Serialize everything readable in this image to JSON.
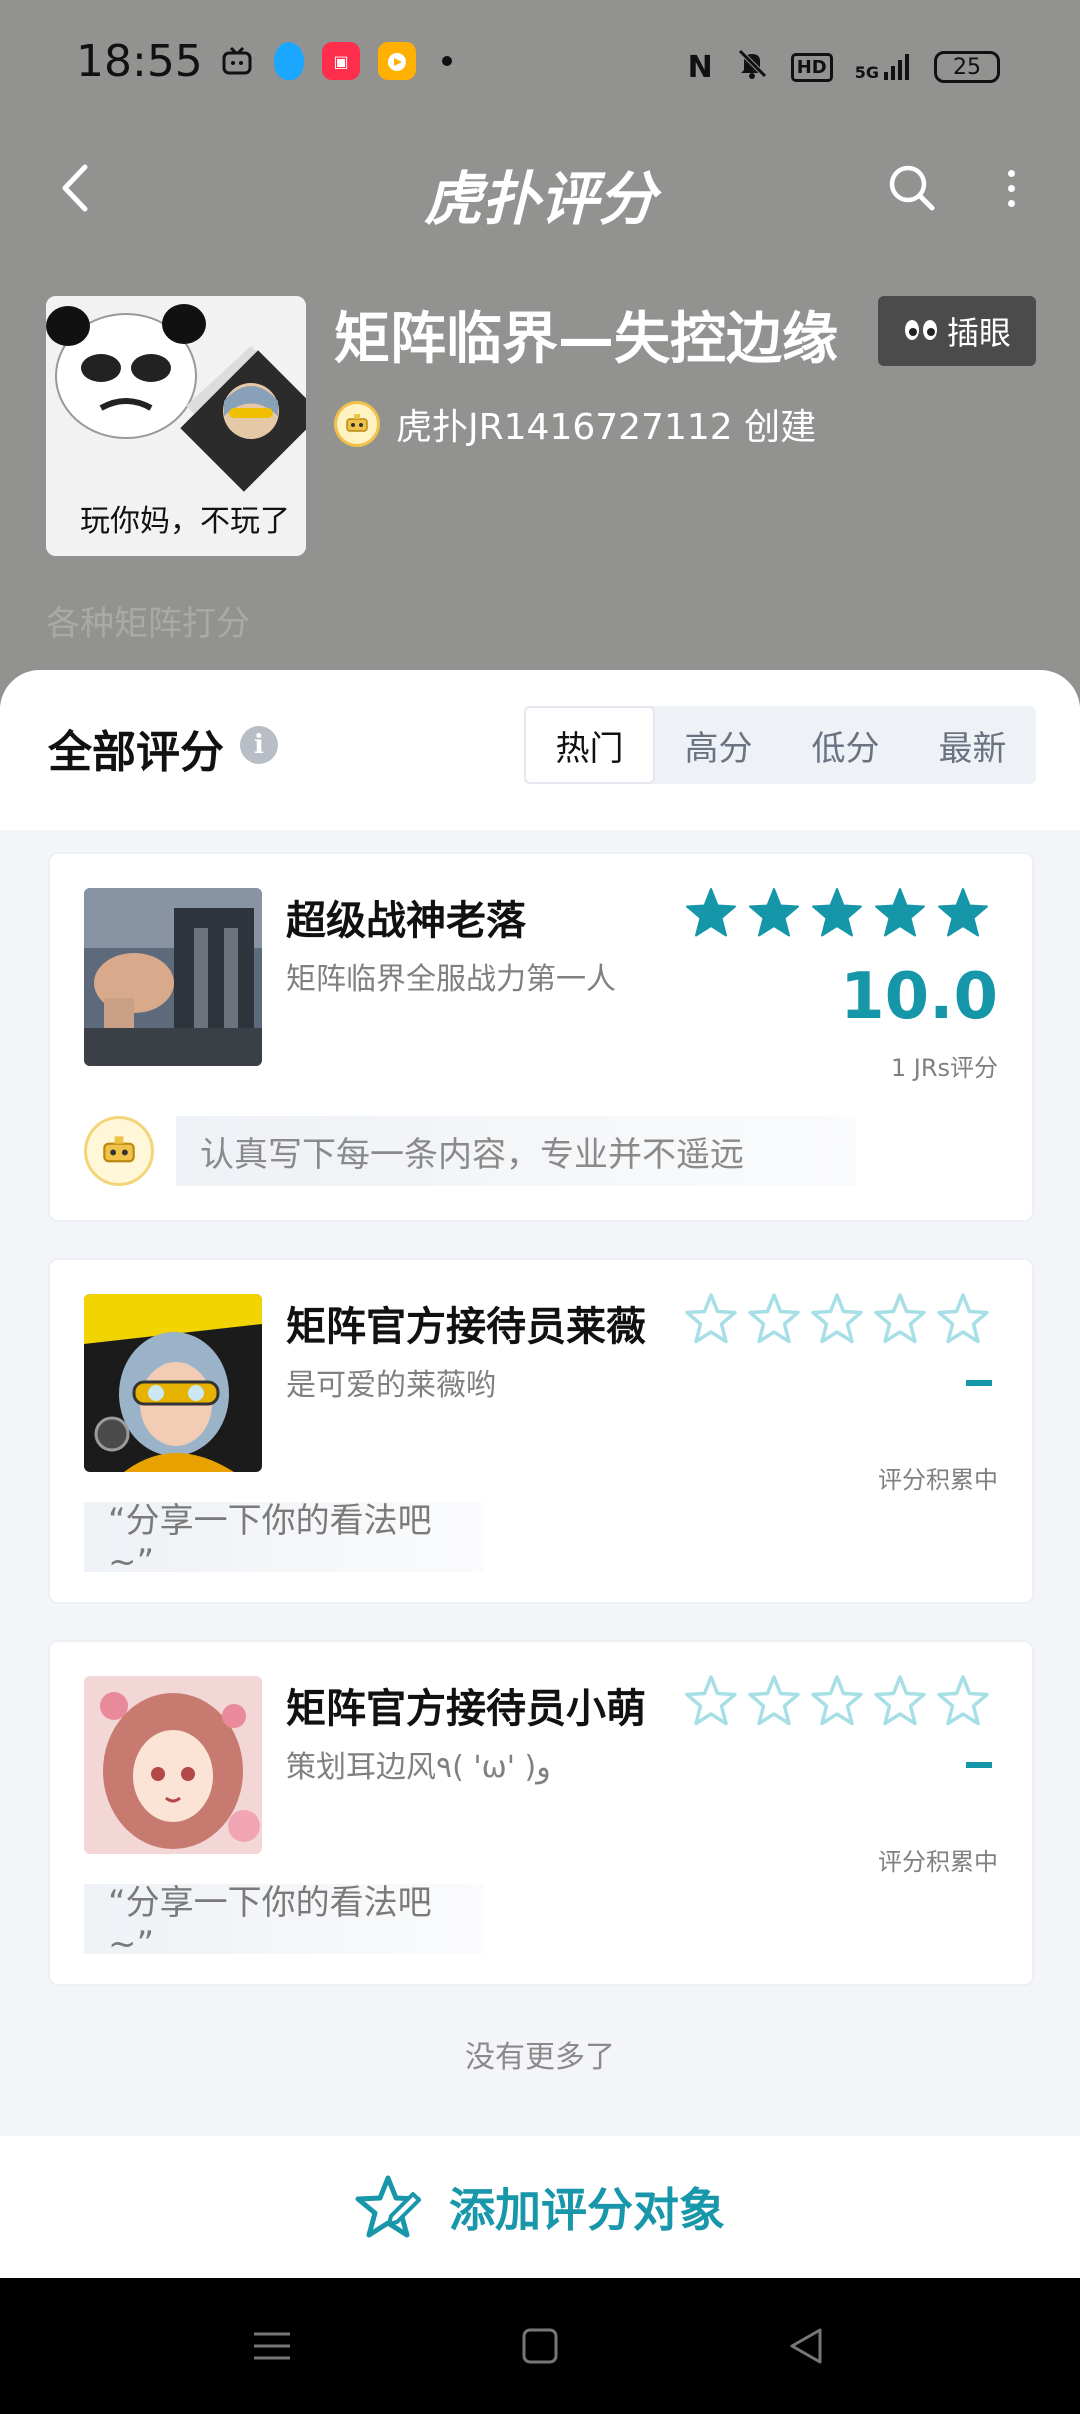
{
  "status_bar": {
    "time": "18:55",
    "network": "5G",
    "hd": "HD",
    "nfc": "N",
    "battery": "25"
  },
  "nav": {
    "logo": "虎扑评分"
  },
  "topic": {
    "title": "矩阵临界—失控边缘",
    "cover_caption": "玩你妈，不玩了",
    "creator": "虎扑JR1416727112 创建",
    "peek_label": "插眼",
    "description": "各种矩阵打分"
  },
  "section": {
    "title": "全部评分",
    "tabs": [
      "热门",
      "高分",
      "低分",
      "最新"
    ],
    "active_tab": "热门"
  },
  "items": [
    {
      "name": "超级战神老落",
      "subtitle": "矩阵临界全服战力第一人",
      "rating": 5,
      "score": "10.0",
      "score_note": "1 JRs评分",
      "review": "认真写下每一条内容，专业并不遥远"
    },
    {
      "name": "矩阵官方接待员莱薇",
      "subtitle": "是可爱的莱薇哟",
      "rating": 0,
      "score_note": "评分积累中",
      "review": "“分享一下你的看法吧~”"
    },
    {
      "name": "矩阵官方接待员小萌",
      "subtitle": "策划耳边风٩( 'ω' )و",
      "rating": 0,
      "score_note": "评分积累中",
      "review": "“分享一下你的看法吧~”"
    }
  ],
  "footer": {
    "no_more": "没有更多了",
    "add_label": "添加评分对象"
  },
  "colors": {
    "accent": "#1696a9",
    "header_bg": "#929391",
    "page_bg": "#f3f5f8"
  }
}
